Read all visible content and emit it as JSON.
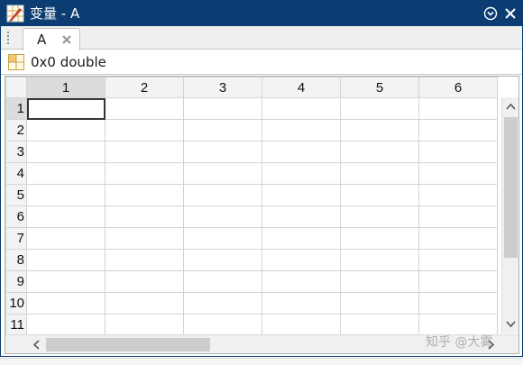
{
  "window": {
    "title": "变量 - A",
    "titlebar_color": "#0b3d73"
  },
  "tabs": [
    {
      "label": "A",
      "active": true
    }
  ],
  "info": {
    "text": "0x0 double",
    "icon": "variable-grid-icon"
  },
  "grid": {
    "columns": [
      "1",
      "2",
      "3",
      "4",
      "5",
      "6"
    ],
    "rows": [
      "1",
      "2",
      "3",
      "4",
      "5",
      "6",
      "7",
      "8",
      "9",
      "10",
      "11"
    ],
    "selected_cell": {
      "row": "1",
      "col": "1"
    }
  },
  "watermark": {
    "text": "知乎 @大雾"
  }
}
